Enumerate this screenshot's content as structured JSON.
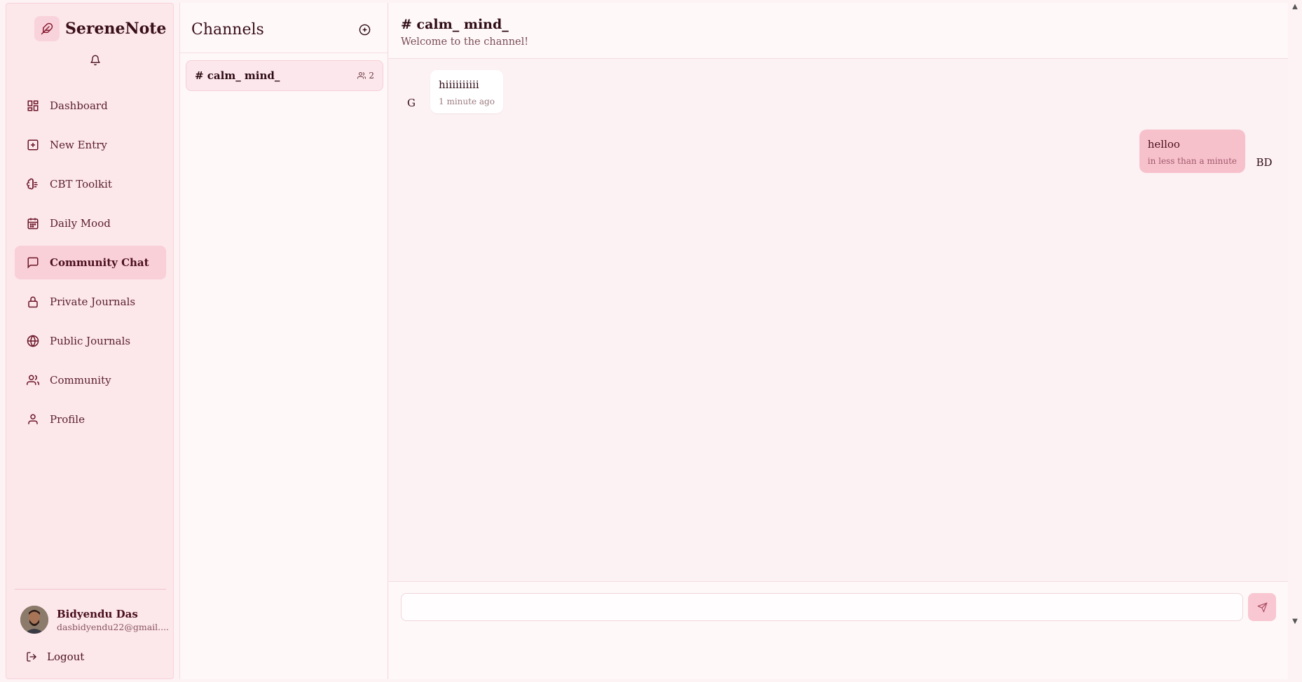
{
  "app": {
    "name": "SereneNote"
  },
  "sidebar": {
    "items": [
      {
        "label": "Dashboard",
        "icon": "dashboard-icon"
      },
      {
        "label": "New Entry",
        "icon": "plus-square-icon"
      },
      {
        "label": "CBT Toolkit",
        "icon": "brain-icon"
      },
      {
        "label": "Daily Mood",
        "icon": "calendar-icon"
      },
      {
        "label": "Community Chat",
        "icon": "chat-icon",
        "active": true
      },
      {
        "label": "Private Journals",
        "icon": "lock-icon"
      },
      {
        "label": "Public Journals",
        "icon": "globe-icon"
      },
      {
        "label": "Community",
        "icon": "users-icon"
      },
      {
        "label": "Profile",
        "icon": "user-icon"
      }
    ],
    "user": {
      "name": "Bidyendu Das",
      "email": "dasbidyendu22@gmail...."
    },
    "logout_label": "Logout"
  },
  "channels": {
    "title": "Channels",
    "list": [
      {
        "name": "# calm_ mind_",
        "members": "2"
      }
    ]
  },
  "chat": {
    "title": "# calm_ mind_",
    "subtitle": "Welcome to the channel!",
    "messages": [
      {
        "sender_initials": "G",
        "text": "hiiiiiiiiii",
        "time": "1 minute ago",
        "own": false
      },
      {
        "sender_initials": "BD",
        "text": "helloo",
        "time": "in less than a minute",
        "own": true
      }
    ],
    "input": {
      "value": "",
      "placeholder": ""
    }
  },
  "colors": {
    "accent": "#f9cfd8",
    "sidebar_bg": "#fce7eb",
    "own_bubble": "#f7c1cc",
    "text_dark": "#3a0f1a"
  }
}
